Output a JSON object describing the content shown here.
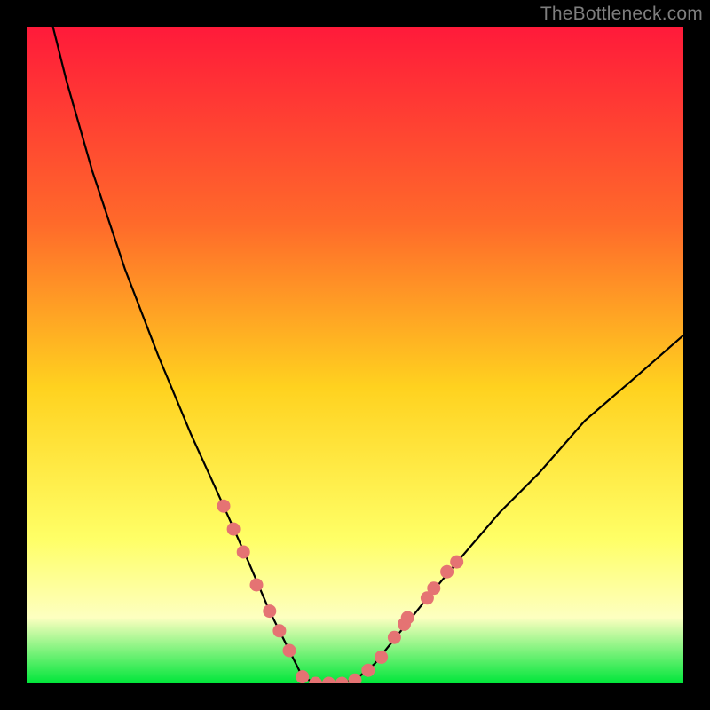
{
  "watermark": "TheBottleneck.com",
  "colors": {
    "frame": "#000000",
    "gradient_top": "#ff1a3a",
    "gradient_mid1": "#ff6a2a",
    "gradient_mid2": "#ffd21f",
    "gradient_mid3": "#ffff66",
    "gradient_mid4": "#fdffc0",
    "gradient_bottom": "#00e63a",
    "curve": "#000000",
    "marker_fill": "#e57373",
    "marker_stroke": "#bb4848"
  },
  "chart_data": {
    "type": "line",
    "title": "",
    "xlabel": "",
    "ylabel": "",
    "xlim": [
      0,
      100
    ],
    "ylim": [
      0,
      100
    ],
    "curve": {
      "description": "V-shaped bottleneck curve with minimum flat segment ~42–50 on x, y≈0; left branch rises steeply to y=100 at x≈4; right branch rises more gently to y≈53 at x=100",
      "points": [
        {
          "x": 4,
          "y": 100
        },
        {
          "x": 6,
          "y": 92
        },
        {
          "x": 10,
          "y": 78
        },
        {
          "x": 15,
          "y": 63
        },
        {
          "x": 20,
          "y": 50
        },
        {
          "x": 25,
          "y": 38
        },
        {
          "x": 30,
          "y": 27
        },
        {
          "x": 34,
          "y": 18
        },
        {
          "x": 37,
          "y": 11
        },
        {
          "x": 40,
          "y": 5
        },
        {
          "x": 42,
          "y": 1
        },
        {
          "x": 44,
          "y": 0
        },
        {
          "x": 47,
          "y": 0
        },
        {
          "x": 50,
          "y": 0.5
        },
        {
          "x": 53,
          "y": 3
        },
        {
          "x": 57,
          "y": 8
        },
        {
          "x": 61,
          "y": 13
        },
        {
          "x": 66,
          "y": 19
        },
        {
          "x": 72,
          "y": 26
        },
        {
          "x": 78,
          "y": 32
        },
        {
          "x": 85,
          "y": 40
        },
        {
          "x": 92,
          "y": 46
        },
        {
          "x": 100,
          "y": 53
        }
      ]
    },
    "markers": [
      {
        "x": 30,
        "y": 27
      },
      {
        "x": 31.5,
        "y": 23.5
      },
      {
        "x": 33,
        "y": 20
      },
      {
        "x": 35,
        "y": 15
      },
      {
        "x": 37,
        "y": 11
      },
      {
        "x": 38.5,
        "y": 8
      },
      {
        "x": 40,
        "y": 5
      },
      {
        "x": 42,
        "y": 1
      },
      {
        "x": 44,
        "y": 0
      },
      {
        "x": 46,
        "y": 0
      },
      {
        "x": 48,
        "y": 0
      },
      {
        "x": 50,
        "y": 0.5
      },
      {
        "x": 52,
        "y": 2
      },
      {
        "x": 54,
        "y": 4
      },
      {
        "x": 56,
        "y": 7
      },
      {
        "x": 57.5,
        "y": 9
      },
      {
        "x": 58,
        "y": 10
      },
      {
        "x": 61,
        "y": 13
      },
      {
        "x": 62,
        "y": 14.5
      },
      {
        "x": 64,
        "y": 17
      },
      {
        "x": 65.5,
        "y": 18.5
      }
    ]
  }
}
